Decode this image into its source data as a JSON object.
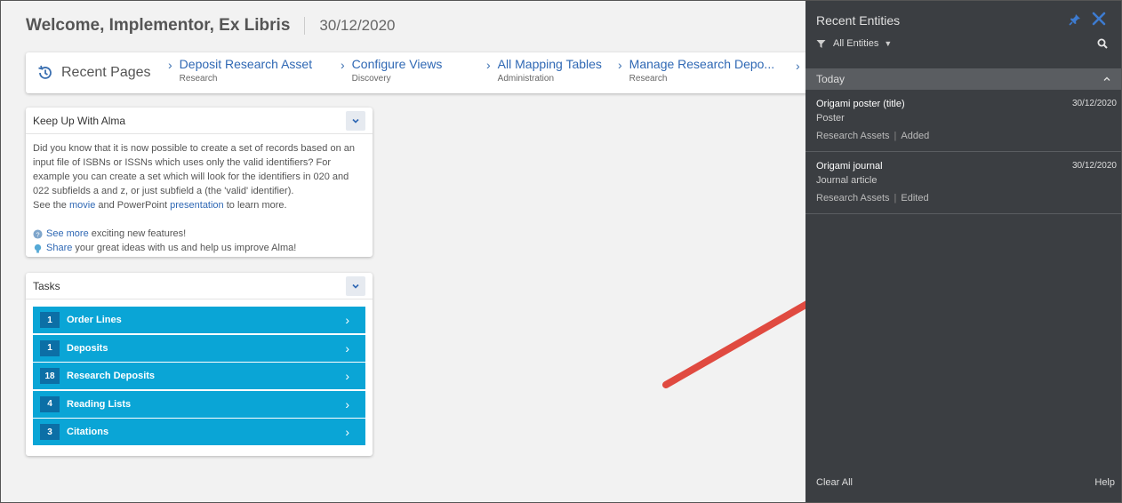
{
  "header": {
    "welcome": "Welcome, Implementor, Ex Libris",
    "date": "30/12/2020"
  },
  "recent_pages": {
    "label": "Recent Pages",
    "items": [
      {
        "title": "Deposit Research Asset",
        "sub": "Research"
      },
      {
        "title": "Configure Views",
        "sub": "Discovery"
      },
      {
        "title": "All Mapping Tables",
        "sub": "Administration"
      },
      {
        "title": "Manage Research Depo...",
        "sub": "Research"
      }
    ]
  },
  "keep_up": {
    "title": "Keep Up With Alma",
    "para": "Did you know that it is now possible to create a set of records based on an input file of ISBNs or ISSNs which uses only the valid identifiers? For example you can create a set which will look for the identifiers in 020 and 022 subfields a and z, or just subfield a (the 'valid' identifier).",
    "see_the": "See the",
    "movie": "movie",
    "and_pp": "and PowerPoint",
    "presentation": "presentation",
    "to_learn": "to learn more.",
    "see_more": "See more",
    "see_more_rest": "exciting new features!",
    "share": "Share",
    "share_rest": "your great ideas with us and help us improve Alma!"
  },
  "tasks": {
    "title": "Tasks",
    "items": [
      {
        "count": "1",
        "label": "Order Lines"
      },
      {
        "count": "1",
        "label": "Deposits"
      },
      {
        "count": "18",
        "label": "Research Deposits"
      },
      {
        "count": "4",
        "label": "Reading Lists"
      },
      {
        "count": "3",
        "label": "Citations"
      }
    ]
  },
  "panel": {
    "title": "Recent Entities",
    "filter": "All Entities",
    "section": "Today",
    "entities": [
      {
        "title": "Origami poster (title)",
        "date": "30/12/2020",
        "type": "Poster",
        "area": "Research Assets",
        "action": "Added"
      },
      {
        "title": "Origami journal",
        "date": "30/12/2020",
        "type": "Journal article",
        "area": "Research Assets",
        "action": "Edited"
      }
    ],
    "clear_all": "Clear All",
    "help": "Help"
  },
  "colors": {
    "task_bg": "#0aa5d6",
    "panel_bg": "#3b3e42",
    "link": "#2f68b4",
    "arrow": "#e04a40"
  }
}
